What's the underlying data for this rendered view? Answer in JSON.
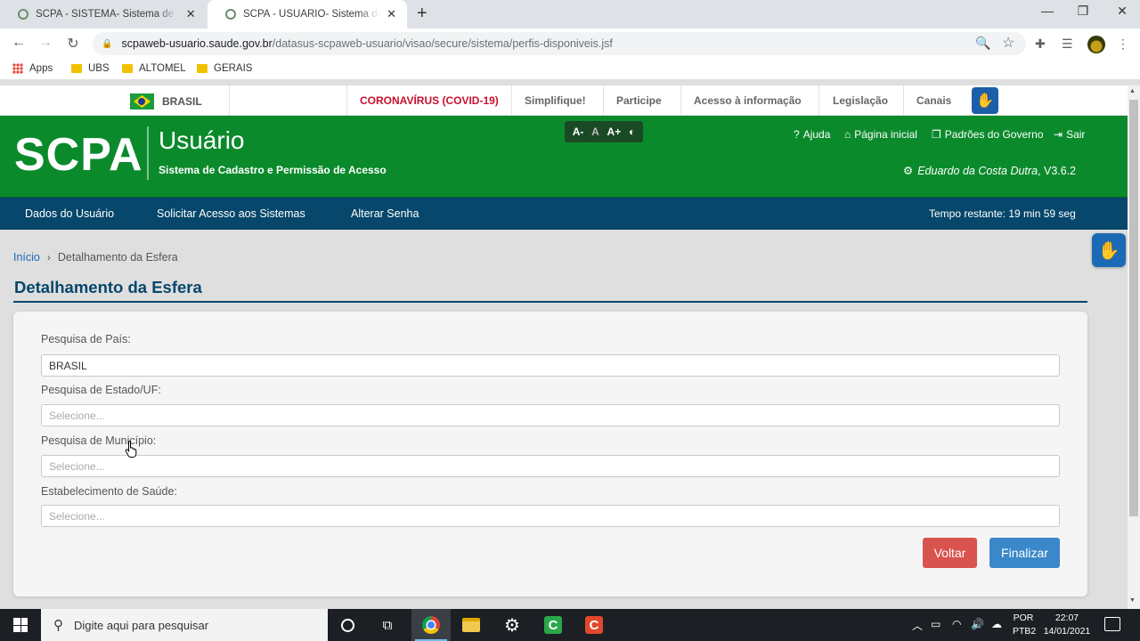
{
  "browser": {
    "tabs": [
      {
        "title": "SCPA - SISTEMA- Sistema de Cadastro e Permissão de Acesso",
        "active": false
      },
      {
        "title": "SCPA - USUARIO- Sistema de Cadastro e Permissão de Acesso",
        "active": true
      }
    ],
    "url_host": "scpaweb-usuario.saude.gov.br",
    "url_path": "/datasus-scpaweb-usuario/visao/secure/sistema/perfis-disponiveis.jsf",
    "bookmarks": [
      "Apps",
      "UBS",
      "ALTOMEL",
      "GERAIS"
    ]
  },
  "govbar": {
    "country": "BRASIL",
    "links": [
      "CORONAVÍRUS (COVID-19)",
      "Simplifique!",
      "Participe",
      "Acesso à informação",
      "Legislação",
      "Canais"
    ]
  },
  "header": {
    "logo": "SCPA",
    "system_name": "Usuário",
    "system_subtitle": "Sistema de Cadastro e Permissão de Acesso",
    "font_controls": [
      "A-",
      "A",
      "A+"
    ],
    "links": {
      "help": "Ajuda",
      "home": "Página inicial",
      "standards": "Padrões do Governo",
      "logout": "Sair"
    },
    "user": "Eduardo da Costa Dutra",
    "version": ", V3.6.2"
  },
  "menu": {
    "items": [
      "Dados do Usuário",
      "Solicitar Acesso aos Sistemas",
      "Alterar Senha"
    ],
    "timer": "Tempo restante: 19 min 59 seg"
  },
  "breadcrumb": {
    "home": "Início",
    "current": "Detalhamento da Esfera"
  },
  "page": {
    "title": "Detalhamento da Esfera",
    "fields": [
      {
        "label": "Pesquisa de País:",
        "value": "BRASIL",
        "placeholder": ""
      },
      {
        "label": "Pesquisa de Estado/UF:",
        "value": "",
        "placeholder": "Selecione..."
      },
      {
        "label": "Pesquisa de Município:",
        "value": "",
        "placeholder": "Selecione..."
      },
      {
        "label": "Estabelecimento de Saúde:",
        "value": "",
        "placeholder": "Selecione..."
      }
    ],
    "buttons": {
      "back": "Voltar",
      "finish": "Finalizar"
    }
  },
  "taskbar": {
    "search_placeholder": "Digite aqui para pesquisar",
    "lang": [
      "POR",
      "PTB2"
    ],
    "time": "22:07",
    "date": "14/01/2021"
  },
  "colors": {
    "header_green": "#0b8a2c",
    "menu_blue": "#06476b",
    "covid_red": "#c8102e",
    "back_button": "#d9534f",
    "finish_button": "#3a87c9"
  }
}
